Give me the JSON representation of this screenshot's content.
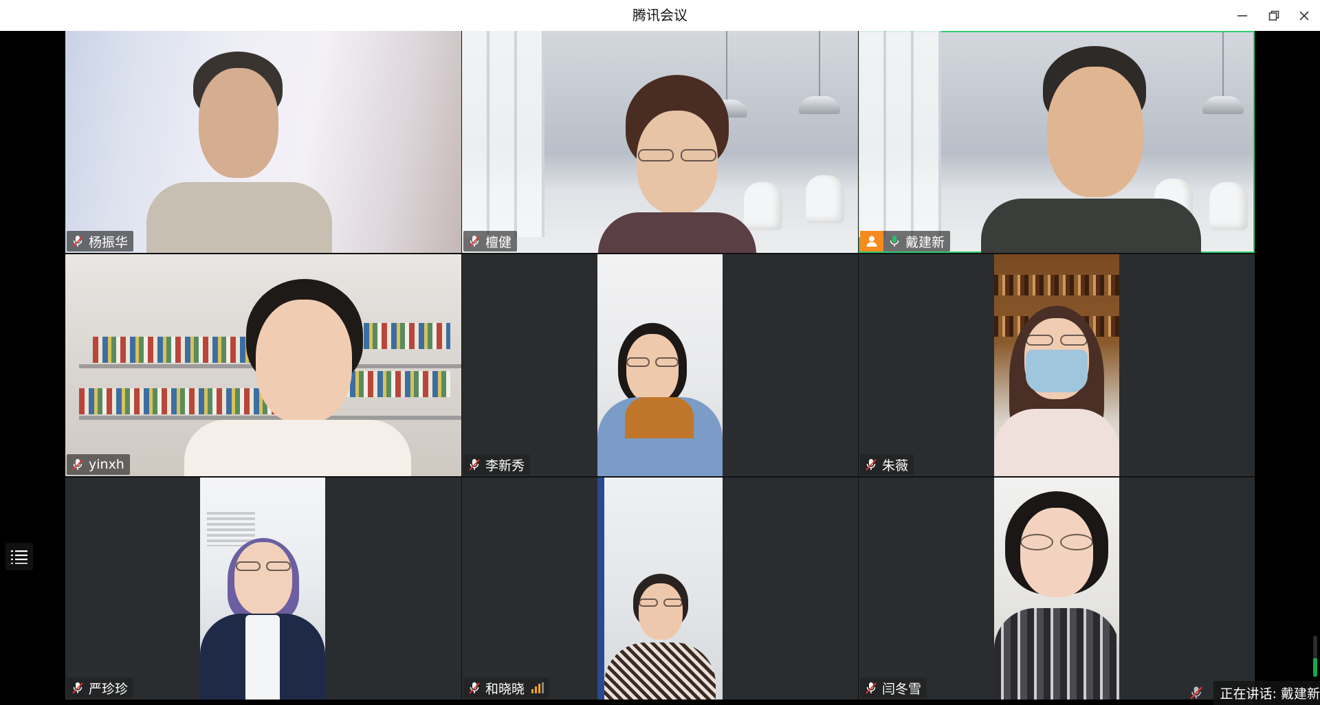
{
  "window": {
    "title": "腾讯会议"
  },
  "participants": [
    {
      "name": "杨振华",
      "mic": "muted",
      "video": "landscape",
      "active": false,
      "host": false
    },
    {
      "name": "檀健",
      "mic": "muted",
      "video": "landscape",
      "active": false,
      "host": false
    },
    {
      "name": "戴建新",
      "mic": "on",
      "video": "landscape",
      "active": true,
      "host": true
    },
    {
      "name": "yinxh",
      "mic": "muted",
      "video": "landscape",
      "active": false,
      "host": false
    },
    {
      "name": "李新秀",
      "mic": "muted",
      "video": "portrait",
      "active": false,
      "host": false
    },
    {
      "name": "朱薇",
      "mic": "muted",
      "video": "portrait",
      "active": false,
      "host": false
    },
    {
      "name": "严珍珍",
      "mic": "muted",
      "video": "portrait",
      "active": false,
      "host": false
    },
    {
      "name": "和晓晓",
      "mic": "muted",
      "video": "portrait",
      "active": false,
      "host": false,
      "signal": "weak"
    },
    {
      "name": "闫冬雪",
      "mic": "muted",
      "video": "portrait",
      "active": false,
      "host": false
    }
  ],
  "footer": {
    "speaking_text": "正在讲话: 戴建新"
  },
  "icons": {
    "minimize": "minimize-icon",
    "restore": "restore-icon",
    "close": "close-icon",
    "muted_mic": "mic-muted-icon",
    "active_mic": "mic-active-icon",
    "host": "host-icon",
    "list": "list-icon",
    "signal": "signal-icon"
  },
  "colors": {
    "active_speaker_border": "#2ecc71",
    "host_badge": "#f58b1e",
    "mic_active": "#22c55e",
    "signal_weak": "#f5a623"
  }
}
